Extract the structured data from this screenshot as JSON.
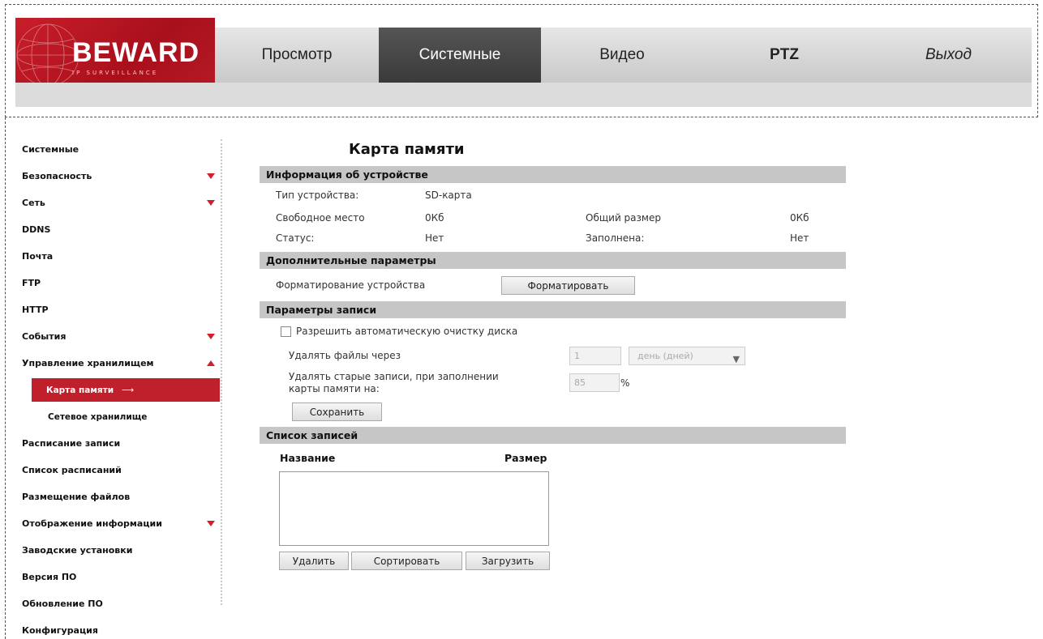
{
  "header": {
    "logo": "BEWARD",
    "logo_sub": "IP SURVEILLANCE",
    "nav": [
      {
        "label": "Просмотр"
      },
      {
        "label": "Системные"
      },
      {
        "label": "Видео"
      },
      {
        "label": "PTZ"
      },
      {
        "label": "Выход"
      }
    ]
  },
  "sidebar": {
    "items": [
      {
        "label": "Системные"
      },
      {
        "label": "Безопасность"
      },
      {
        "label": "Сеть"
      },
      {
        "label": "DDNS"
      },
      {
        "label": "Почта"
      },
      {
        "label": "FTP"
      },
      {
        "label": "HTTP"
      },
      {
        "label": "События"
      },
      {
        "label": "Управление хранилищем"
      },
      {
        "label": "Карта памяти"
      },
      {
        "label": "Сетевое хранилище"
      },
      {
        "label": "Расписание записи"
      },
      {
        "label": "Список расписаний"
      },
      {
        "label": "Размещение файлов"
      },
      {
        "label": "Отображение информации"
      },
      {
        "label": "Заводские установки"
      },
      {
        "label": "Версия ПО"
      },
      {
        "label": "Обновление ПО"
      },
      {
        "label": "Конфигурация"
      }
    ]
  },
  "main": {
    "title": "Карта памяти",
    "device_info": {
      "header": "Информация об устройстве",
      "type_label": "Тип устройства:",
      "type_value": "SD-карта",
      "free_label": "Свободное место",
      "free_value": "0Кб",
      "total_label": "Общий размер",
      "total_value": "0Кб",
      "status_label": "Статус:",
      "status_value": "Нет",
      "full_label": "Заполнена:",
      "full_value": "Нет"
    },
    "extra": {
      "header": "Дополнительные параметры",
      "format_label": "Форматирование устройства",
      "format_button": "Форматировать"
    },
    "record": {
      "header": "Параметры записи",
      "auto_clean_label": "Разрешить автоматическую очистку диска",
      "auto_clean_checked": false,
      "delete_after_label": "Удалять файлы через",
      "delete_after_value": "1",
      "delete_after_unit": "день (дней)",
      "delete_old_label_1": "Удалять старые записи, при заполнении",
      "delete_old_label_2": "карты памяти на:",
      "delete_old_value": "85",
      "delete_old_unit": "%",
      "save_button": "Сохранить"
    },
    "records": {
      "header": "Список записей",
      "col_name": "Название",
      "col_size": "Размер",
      "rows": [],
      "delete_button": "Удалить",
      "sort_button": "Сортировать",
      "load_button": "Загрузить"
    }
  }
}
